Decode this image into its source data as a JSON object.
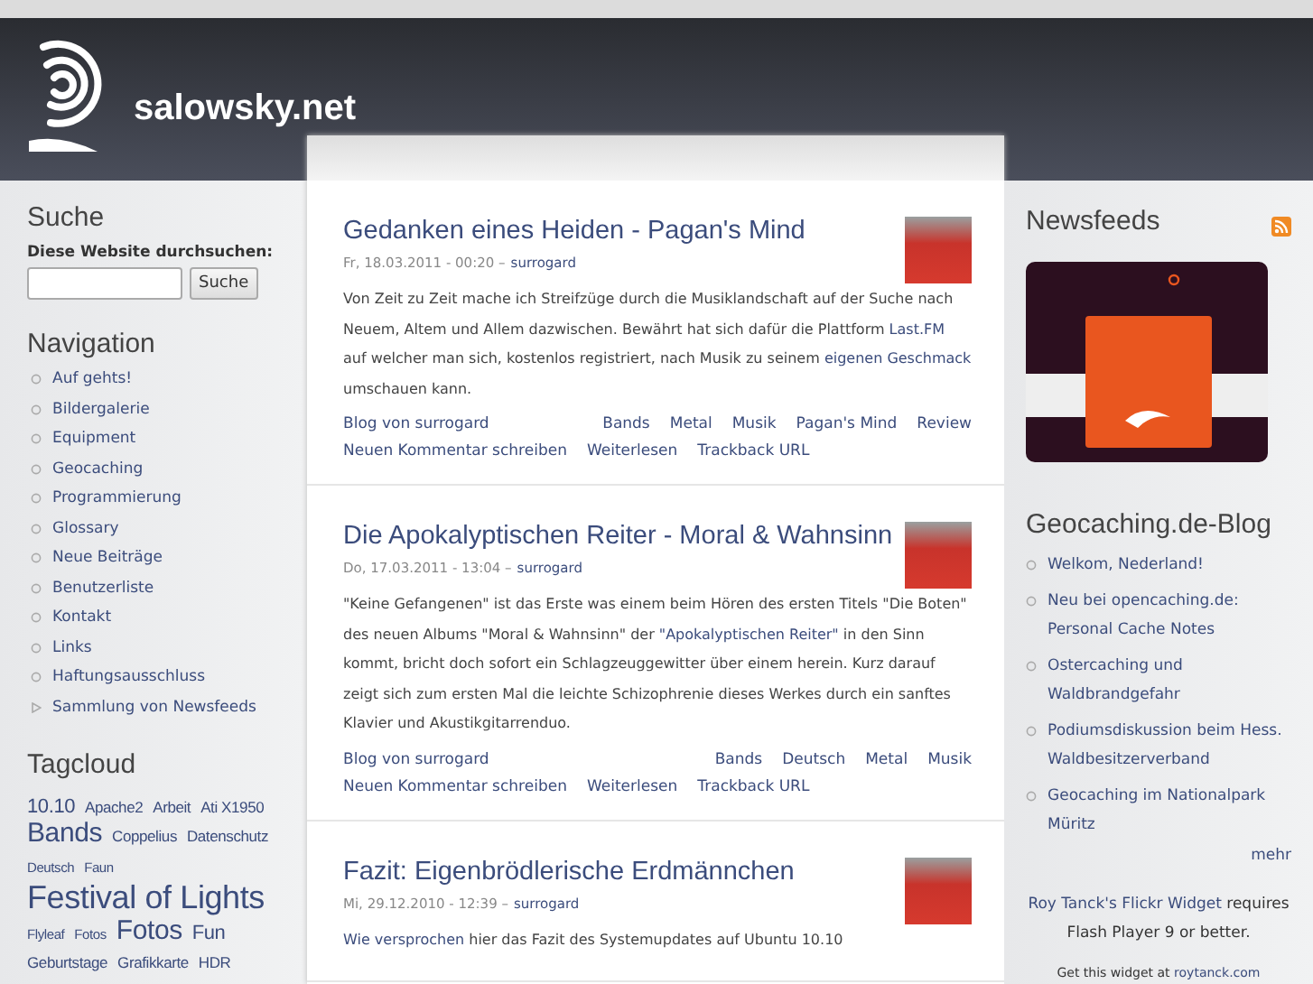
{
  "site": {
    "title": "salowsky.net"
  },
  "search": {
    "heading": "Suche",
    "label": "Diese Website durchsuchen:",
    "button": "Suche"
  },
  "navigation": {
    "heading": "Navigation",
    "items": [
      {
        "label": "Auf gehts!",
        "kind": "leaf"
      },
      {
        "label": "Bildergalerie",
        "kind": "leaf"
      },
      {
        "label": "Equipment",
        "kind": "leaf"
      },
      {
        "label": "Geocaching",
        "kind": "leaf"
      },
      {
        "label": "Programmierung",
        "kind": "leaf"
      },
      {
        "label": "Glossary",
        "kind": "leaf"
      },
      {
        "label": "Neue Beiträge",
        "kind": "leaf"
      },
      {
        "label": "Benutzerliste",
        "kind": "leaf"
      },
      {
        "label": "Kontakt",
        "kind": "leaf"
      },
      {
        "label": "Links",
        "kind": "leaf"
      },
      {
        "label": "Haftungsausschluss",
        "kind": "leaf"
      },
      {
        "label": "Sammlung von Newsfeeds",
        "kind": "expandable"
      }
    ]
  },
  "tagcloud": {
    "heading": "Tagcloud",
    "tags": [
      {
        "label": "10.10",
        "kind": "medium"
      },
      {
        "label": "Apache2",
        "kind": "small"
      },
      {
        "label": "Arbeit",
        "kind": "small"
      },
      {
        "label": "Ati X1950",
        "kind": "small"
      },
      {
        "label": "Bands",
        "kind": "large"
      },
      {
        "label": "Coppelius",
        "kind": "small"
      },
      {
        "label": "Datenschutz",
        "kind": "small"
      },
      {
        "label": "Deutsch",
        "kind": "tiny"
      },
      {
        "label": "Faun",
        "kind": "tiny"
      },
      {
        "label": "Festival of Lights",
        "kind": "huge"
      },
      {
        "label": "Flyleaf",
        "kind": "tiny"
      },
      {
        "label": "Fotos",
        "kind": "tiny"
      },
      {
        "label": "Fotos",
        "kind": "large"
      },
      {
        "label": "Fun",
        "kind": "medium"
      },
      {
        "label": "Geburtstage",
        "kind": "small"
      },
      {
        "label": "Grafikkarte",
        "kind": "small"
      },
      {
        "label": "HDR",
        "kind": "small"
      }
    ]
  },
  "posts": [
    {
      "title": "Gedanken eines Heiden - Pagan's Mind",
      "date": "Fr, 18.03.2011 - 00:20 –",
      "author": "surrogard",
      "body": [
        {
          "text": "Von Zeit zu Zeit mache ich Streifzüge durch die Musiklandschaft auf der Suche nach Neuem, Altem und Allem dazwischen. Bewährt hat sich dafür die Plattform ",
          "link": false
        },
        {
          "text": "Last.FM",
          "link": true
        },
        {
          "text": " auf welcher man sich, kostenlos registriert, nach Musik zu seinem ",
          "link": false
        },
        {
          "text": "eigenen Geschmack",
          "link": true
        },
        {
          "text": " umschauen kann.",
          "link": false
        }
      ],
      "links": [
        "Blog von surrogard",
        "Neuen Kommentar schreiben",
        "Weiterlesen",
        "Trackback URL"
      ],
      "tags": [
        "Bands",
        "Metal",
        "Musik",
        "Pagan's Mind",
        "Review"
      ]
    },
    {
      "title": "Die Apokalyptischen Reiter - Moral & Wahnsinn",
      "date": "Do, 17.03.2011 - 13:04 –",
      "author": "surrogard",
      "body": [
        {
          "text": "\"Keine Gefangenen\" ist das Erste was einem beim Hören des ersten Titels \"Die Boten\" des neuen Albums \"Moral & Wahnsinn\" der ",
          "link": false
        },
        {
          "text": "\"Apokalyptischen Reiter\"",
          "link": true
        },
        {
          "text": " in den Sinn kommt, bricht doch sofort ein Schlagzeuggewitter über einem herein. Kurz darauf zeigt sich zum ersten Mal die leichte Schizophrenie dieses Werkes durch ein sanftes Klavier und Akustikgitarrenduo.",
          "link": false
        }
      ],
      "links": [
        "Blog von surrogard",
        "Neuen Kommentar schreiben",
        "Weiterlesen",
        "Trackback URL"
      ],
      "tags": [
        "Bands",
        "Deutsch",
        "Metal",
        "Musik"
      ]
    },
    {
      "title": "Fazit: Eigenbrödlerische Erdmännchen",
      "date": "Mi, 29.12.2010 - 12:39 –",
      "author": "surrogard",
      "body": [
        {
          "text": "Wie versprochen",
          "link": true
        },
        {
          "text": " hier das Fazit des Systemupdates auf Ubuntu 10.10",
          "link": false
        }
      ]
    }
  ],
  "newsfeeds": {
    "heading": "Newsfeeds"
  },
  "blog": {
    "heading": "Geocaching.de-Blog",
    "items": [
      "Welkom, Nederland!",
      "Neu bei opencaching.de: Personal Cache Notes",
      "Ostercaching und Waldbrandgefahr",
      "Podiumsdiskussion beim Hess. Waldbesitzerverband",
      "Geocaching im Nationalpark Müritz"
    ],
    "more": "mehr"
  },
  "flickr": {
    "link": "Roy Tanck's Flickr Widget",
    "text": "requires Flash Player 9 or better.",
    "get_text": "Get this widget at",
    "get_link": "roytanck.com"
  }
}
